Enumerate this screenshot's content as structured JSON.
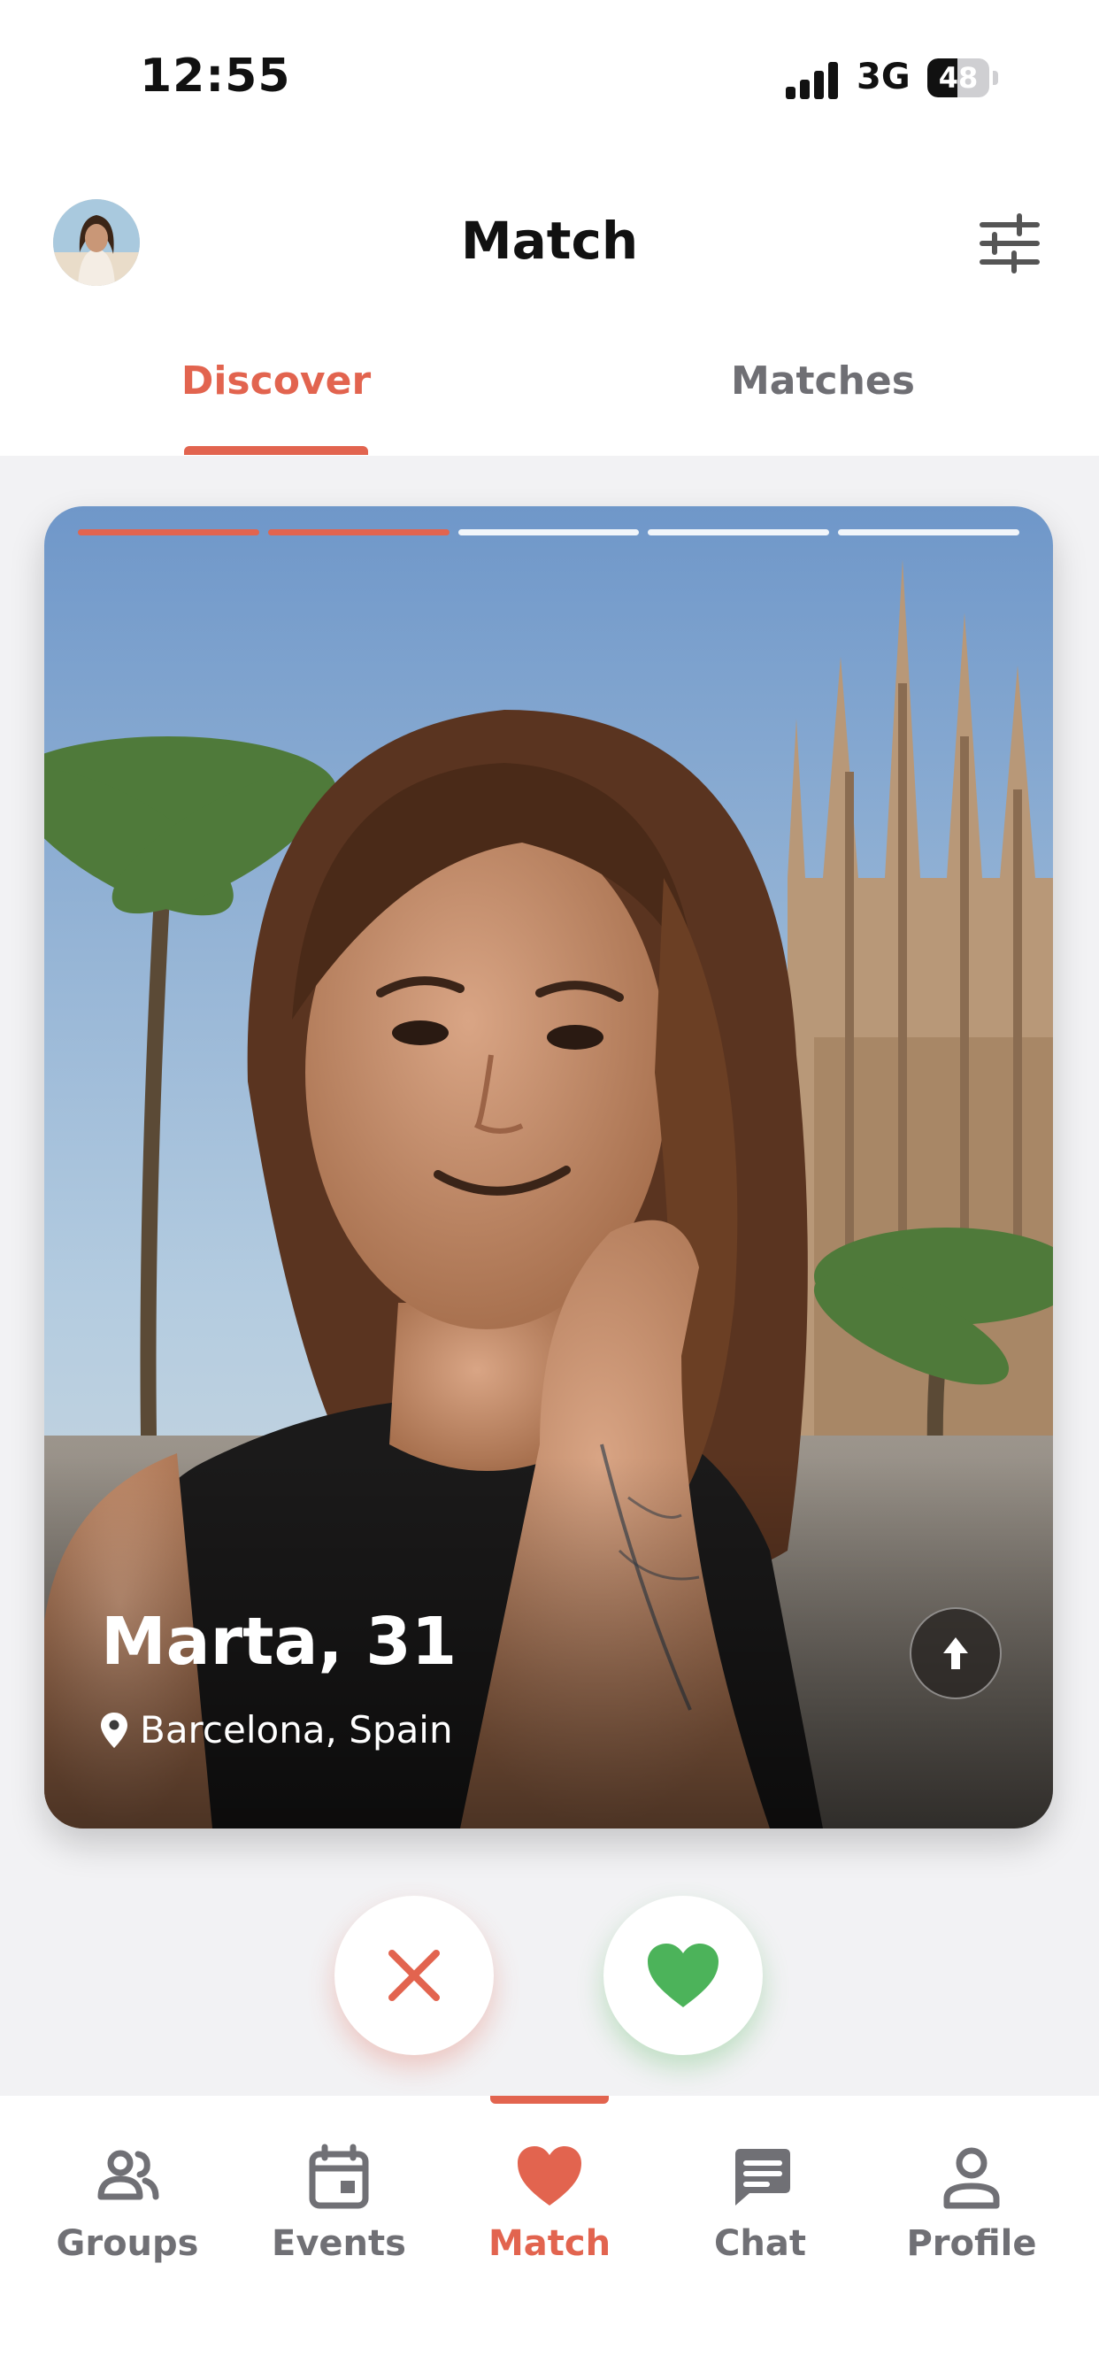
{
  "status_bar": {
    "time": "12:55",
    "network": "3G",
    "battery": "48",
    "battery_level": 0.48
  },
  "header": {
    "title": "Match",
    "avatar_icon": "user-avatar",
    "filter_icon": "sliders-icon"
  },
  "tabs": [
    {
      "label": "Discover",
      "active": true
    },
    {
      "label": "Matches",
      "active": false
    }
  ],
  "profile_card": {
    "name_age": "Marta, 31",
    "location": "Barcelona, Spain",
    "photo_count": 5,
    "photos_viewed": 2
  },
  "actions": {
    "pass_icon": "close-icon",
    "like_icon": "heart-icon"
  },
  "bottom_nav": [
    {
      "label": "Groups",
      "icon": "groups-icon",
      "active": false
    },
    {
      "label": "Events",
      "icon": "calendar-icon",
      "active": false
    },
    {
      "label": "Match",
      "icon": "heart-icon",
      "active": true
    },
    {
      "label": "Chat",
      "icon": "chat-icon",
      "active": false
    },
    {
      "label": "Profile",
      "icon": "person-icon",
      "active": false
    }
  ],
  "colors": {
    "accent": "#e2644f",
    "like": "#4cb35a",
    "inactive": "#707075"
  }
}
